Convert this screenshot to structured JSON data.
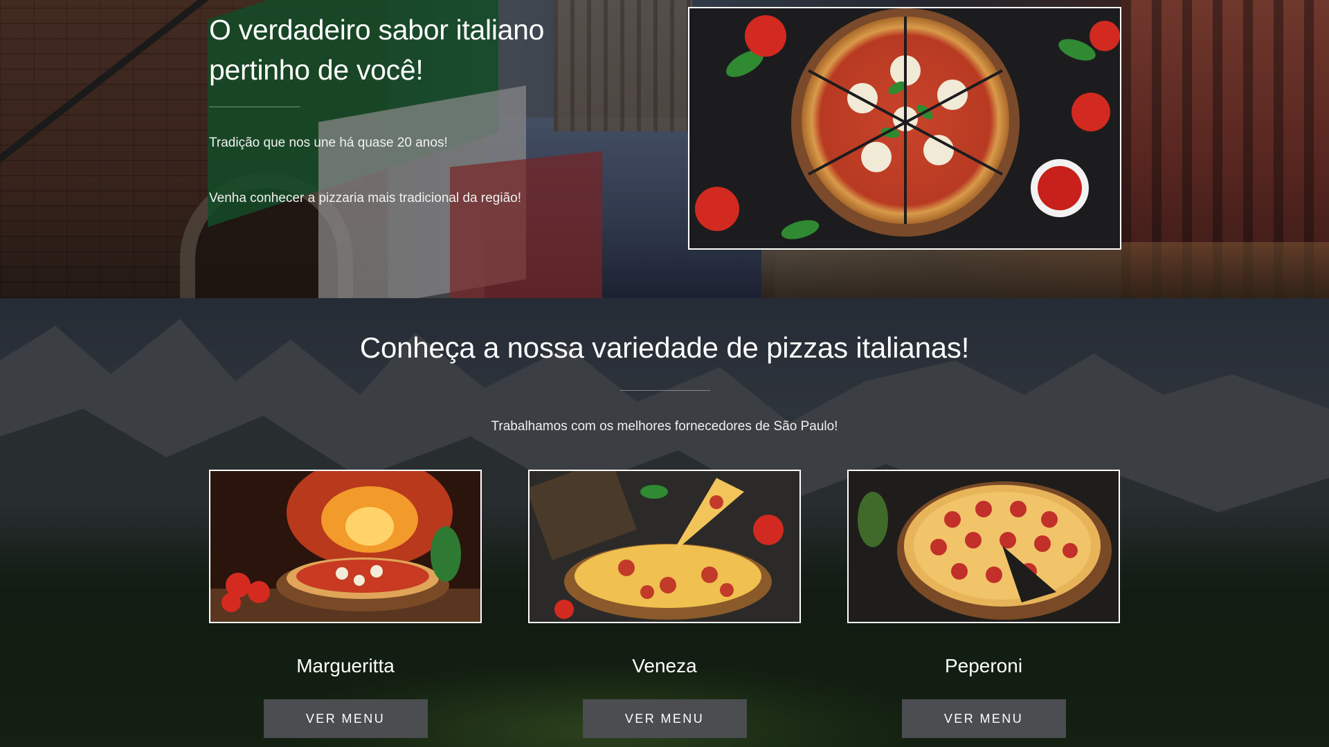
{
  "hero": {
    "title_line1": "O verdadeiro sabor italiano",
    "title_line2": "pertinho de você!",
    "text1": "Tradição que nos une há quase 20 anos!",
    "text2": "Venha conhecer a pizzaria mais tradicional da região!"
  },
  "pizzas": {
    "title": "Conheça a nossa variedade de pizzas italianas!",
    "subtitle": "Trabalhamos com os melhores fornecedores de São Paulo!",
    "cards": [
      {
        "name": "Margueritta",
        "button": "Ver menu"
      },
      {
        "name": "Veneza",
        "button": "Ver menu"
      },
      {
        "name": "Peperoni",
        "button": "Ver menu"
      }
    ]
  },
  "colors": {
    "button_bg": "#4b4d50",
    "text": "#ffffff",
    "flag_green": "#1f7a3f",
    "flag_red": "#c23a3a"
  }
}
